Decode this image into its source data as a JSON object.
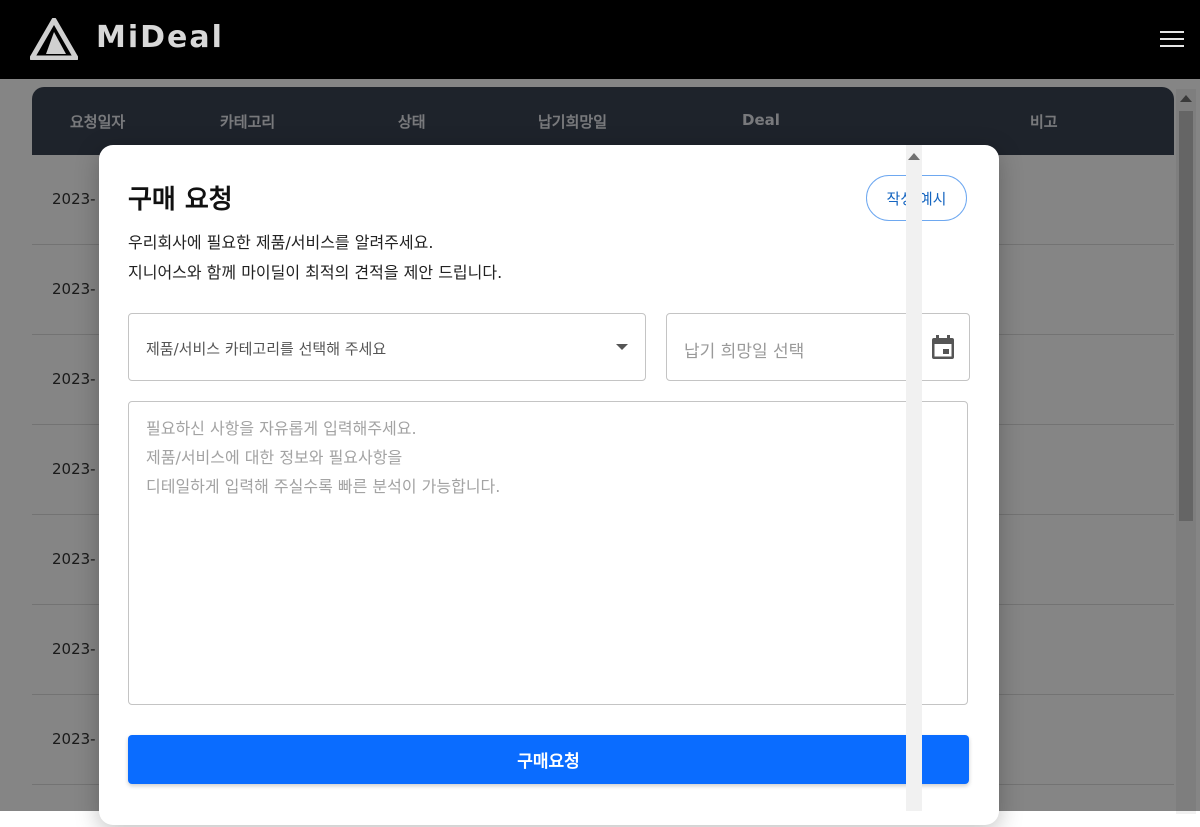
{
  "header": {
    "logo_text": "MiDeal",
    "menu_icon": "hamburger-menu-icon"
  },
  "table": {
    "columns": [
      "요청일자",
      "카테고리",
      "상태",
      "납기희망일",
      "Deal",
      "비고"
    ],
    "rows": [
      {
        "date": "2023-"
      },
      {
        "date": "2023-"
      },
      {
        "date": "2023-"
      },
      {
        "date": "2023-"
      },
      {
        "date": "2023-"
      },
      {
        "date": "2023-"
      },
      {
        "date": "2023-"
      }
    ]
  },
  "modal": {
    "title": "구매 요청",
    "example_button": "작성 예시",
    "description": [
      "우리회사에 필요한 제품/서비스를 알려주세요.",
      "지니어스와 함께 마이딜이 최적의 견적을 제안 드립니다."
    ],
    "category_placeholder": "제품/서비스 카테고리를 선택해 주세요",
    "date_placeholder": "납기 희망일 선택",
    "calendar_icon": "calendar-icon",
    "textarea_placeholder": [
      "필요하신 사항을 자유롭게 입력해주세요.",
      "제품/서비스에 대한 정보와 필요사항을",
      "디테일하게 입력해 주실수록 빠른 분석이 가능합니다."
    ],
    "submit_button": "구매요청"
  },
  "colors": {
    "topbar": "#000000",
    "table_header": "#3b4453",
    "primary": "#0a6cff",
    "outline_accent": "#6ea8f0"
  }
}
